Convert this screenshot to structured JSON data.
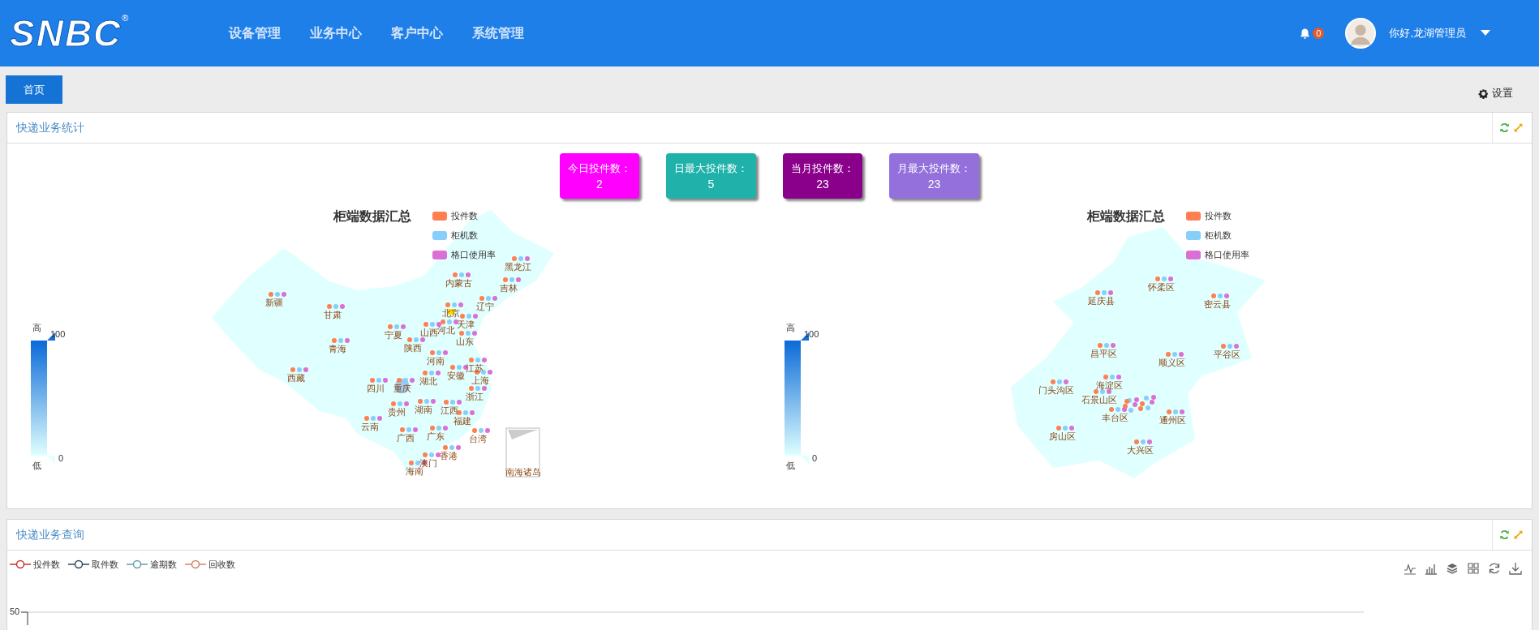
{
  "header": {
    "logo": "SNBC",
    "logo_mark": "®",
    "nav": [
      {
        "label": "设备管理"
      },
      {
        "label": "业务中心"
      },
      {
        "label": "客户中心"
      },
      {
        "label": "系统管理"
      }
    ],
    "notification_count": "0",
    "greeting": "你好,龙湖管理员"
  },
  "tabs": [
    {
      "label": "首页",
      "selected": true
    }
  ],
  "settings_label": "设置",
  "stats_panel": {
    "title": "快递业务统计",
    "cards": [
      {
        "label": "今日投件数：",
        "value": "2",
        "color": "#ff00ff"
      },
      {
        "label": "日最大投件数：",
        "value": "5",
        "color": "#20b2aa"
      },
      {
        "label": "当月投件数：",
        "value": "23",
        "color": "#8b008b"
      },
      {
        "label": "月最大投件数：",
        "value": "23",
        "color": "#9370db"
      }
    ],
    "maps": [
      {
        "kind": "china",
        "title": "柜端数据汇总",
        "legend": [
          {
            "label": "投件数",
            "color": "#ff7f50"
          },
          {
            "label": "柜机数",
            "color": "#87cefa"
          },
          {
            "label": "格口使用率",
            "color": "#da70d6"
          }
        ],
        "scale_high": "高",
        "scale_max": "100",
        "scale_min": "0",
        "scale_low": "低",
        "regions": [
          "新疆",
          "甘肃",
          "青海",
          "西藏",
          "内蒙古",
          "黑龙江",
          "吉林",
          "辽宁",
          "北京",
          "天津",
          "河北",
          "宁夏",
          "山西",
          "陕西",
          "山东",
          "河南",
          "江苏",
          "安徽",
          "湖北",
          "上海",
          "四川",
          "重庆",
          "浙江",
          "贵州",
          "湖南",
          "江西",
          "福建",
          "云南",
          "广西",
          "广东",
          "台湾",
          "香港",
          "澳门",
          "海南"
        ],
        "inset_label": "南海诸岛"
      },
      {
        "kind": "beijing",
        "title": "柜端数据汇总",
        "legend": [
          {
            "label": "投件数",
            "color": "#ff7f50"
          },
          {
            "label": "柜机数",
            "color": "#87cefa"
          },
          {
            "label": "格口使用率",
            "color": "#da70d6"
          }
        ],
        "scale_high": "高",
        "scale_max": "100",
        "scale_min": "0",
        "scale_low": "低",
        "regions": [
          "怀柔区",
          "延庆县",
          "密云县",
          "昌平区",
          "顺义区",
          "平谷区",
          "海淀区",
          "门头沟区",
          "石景山区",
          "丰台区",
          "通州区",
          "房山区",
          "大兴区"
        ]
      }
    ]
  },
  "query_panel": {
    "title": "快递业务查询",
    "legend": [
      {
        "label": "投件数",
        "color": "#c23531"
      },
      {
        "label": "取件数",
        "color": "#2f4554"
      },
      {
        "label": "逾期数",
        "color": "#61a0a8"
      },
      {
        "label": "回收数",
        "color": "#d48265"
      }
    ],
    "y_tick": "50"
  }
}
